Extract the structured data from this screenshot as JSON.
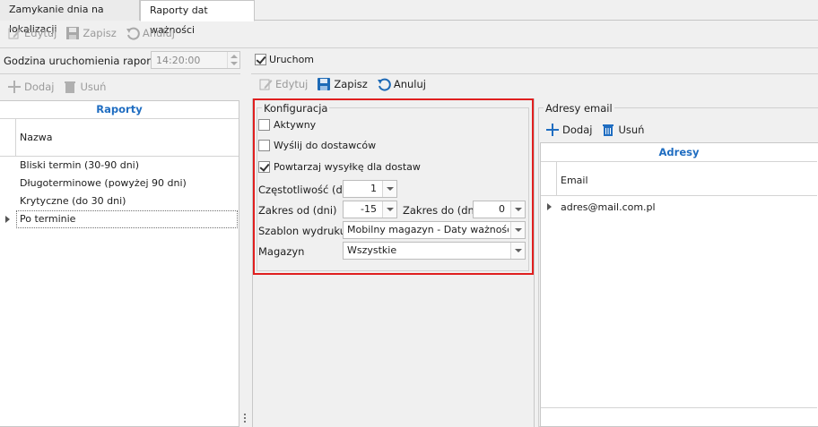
{
  "tabs": [
    "Zamykanie dnia na lokalizacji",
    "Raporty dat ważności"
  ],
  "top_toolbar": {
    "edit": "Edytuj",
    "save": "Zapisz",
    "cancel": "Anuluj"
  },
  "schedule": {
    "label": "Godzina uruchomienia raportów",
    "time": "14:20:00",
    "run_label": "Uruchom"
  },
  "left_toolbar": {
    "add": "Dodaj",
    "remove": "Usuń"
  },
  "reports": {
    "header": "Raporty",
    "column": "Nazwa",
    "rows": [
      "Bliski termin (30-90 dni)",
      "Długoterminowe (powyżej 90 dni)",
      "Krytyczne (do 30 dni)",
      "Po terminie"
    ]
  },
  "mid_toolbar": {
    "edit": "Edytuj",
    "save": "Zapisz",
    "cancel": "Anuluj"
  },
  "config": {
    "title": "Konfiguracja",
    "active": "Aktywny",
    "send_suppliers": "Wyślij do dostawców",
    "repeat": "Powtarzaj wysyłkę dla dostaw",
    "frequency_label": "Częstotliwość (dni)",
    "frequency": "1",
    "range_from_label": "Zakres od (dni)",
    "range_from": "-15",
    "range_to_label": "Zakres do (dni)",
    "range_to": "0",
    "template_label": "Szablon wydruku",
    "template": "Mobilny magazyn - Daty ważności (...",
    "warehouse_label": "Magazyn",
    "warehouse": "Wszystkie"
  },
  "emails": {
    "group_title": "Adresy email",
    "add": "Dodaj",
    "remove": "Usuń",
    "header": "Adresy",
    "column": "Email",
    "rows": [
      "adres@mail.com.pl"
    ]
  },
  "colors": {
    "accent": "#1f6dc1",
    "highlight": "#e01f1f",
    "add_icon": "#1f6dc1"
  }
}
